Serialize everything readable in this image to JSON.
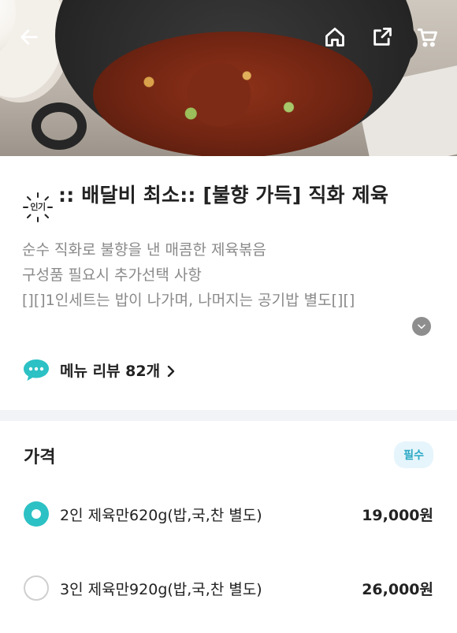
{
  "header": {
    "back_icon": "arrow-left-icon",
    "home_icon": "home-icon",
    "share_icon": "share-icon",
    "cart_icon": "cart-icon"
  },
  "menu": {
    "badge": "인기",
    "title": ":: 배달비 최소:: [불향 가득] 직화 제육",
    "description_lines": [
      "순수 직화로 불향을 낸 매콤한 제육볶음",
      "구성품 필요시 추가선택 사항",
      "[][]1인세트는 밥이 나가며, 나머지는 공기밥 별도[][]"
    ],
    "review_label": "메뉴 리뷰 82개"
  },
  "price_section": {
    "title": "가격",
    "required_badge": "필수",
    "options": [
      {
        "label": "2인 제육만620g(밥,국,찬 별도)",
        "price": "19,000원",
        "selected": true
      },
      {
        "label": "3인 제육만920g(밥,국,찬 별도)",
        "price": "26,000원",
        "selected": false
      }
    ]
  },
  "colors": {
    "accent": "#2cc1c4",
    "required_bg": "#e6f5fb",
    "required_text": "#2aa7c4",
    "muted_text": "#8a8a8a",
    "divider": "#f2f3f7"
  }
}
